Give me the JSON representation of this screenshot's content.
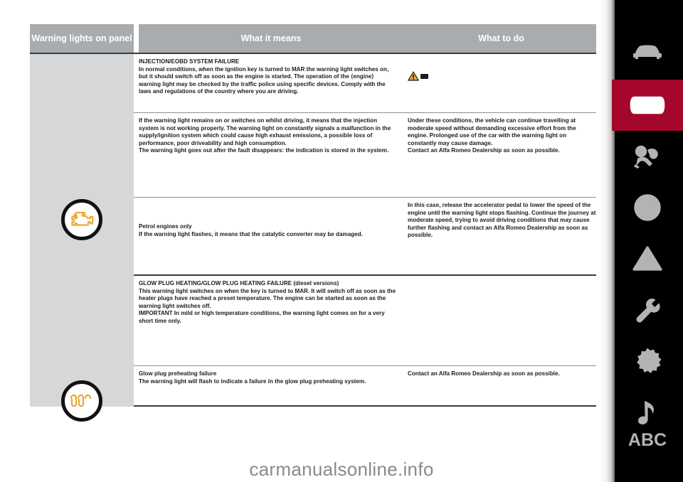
{
  "table": {
    "headers": {
      "col1": "Warning lights on panel",
      "col2": "What it means",
      "col3": "What to do"
    },
    "rows": [
      {
        "icon_name": "engine-check-warning-light",
        "icon_color": "#E8A830",
        "blocks": [
          {
            "means_title": "INJECTION/EOBD SYSTEM FAILURE",
            "means_body": "In normal conditions, when the ignition key is turned to MAR the warning light switches on, but it should switch off as soon as the engine is started. The operation of the ⟨engine⟩ warning light may be checked by the traffic police using specific devices. Comply with the laws and regulations of the country where you are driving.",
            "todo": ""
          },
          {
            "means_title": "",
            "means_body": "If the warning light remains on or switches on whilst driving, it means that the injection system is not working properly. The warning light on constantly signals a malfunction in the supply/ignition system which could cause high exhaust emissions, a possible loss of performance, poor driveability and high consumption.\nThe warning light goes out after the fault disappears: the indication is stored in the system.",
            "todo": "Under these conditions, the vehicle can continue travelling at moderate speed without demanding excessive effort from the engine. Prolonged use of the car with the warning light on constantly may cause damage.\nContact an Alfa Romeo Dealership as soon as possible."
          },
          {
            "means_title": "Petrol engines only",
            "means_body": "If the warning light flashes, it means that the catalytic converter may be damaged.",
            "todo": "In this case, release the accelerator pedal to lower the speed of the engine until the warning light stops flashing. Continue the journey at moderate speed, trying to avoid driving conditions that may cause further flashing and contact an Alfa Romeo Dealership as soon as possible."
          }
        ]
      },
      {
        "icon_name": "glow-plug-preheating-warning-light",
        "icon_color": "#E8A830",
        "blocks": [
          {
            "means_title": "GLOW PLUG HEATING/GLOW PLUG HEATING FAILURE (diesel versions)",
            "means_body": "This warning light switches on when the key is turned to MAR. It will switch off as soon as the heater plugs have reached a preset temperature. The engine can be started as soon as the warning light switches off.\nIMPORTANT In mild or high temperature conditions, the warning light comes on for a very short time only.",
            "todo": ""
          },
          {
            "means_title": "Glow plug preheating failure",
            "means_body": "The warning light will flash to indicate a failure in the glow plug preheating system.",
            "todo": "Contact an Alfa Romeo Dealership as soon as possible."
          }
        ]
      }
    ]
  },
  "sidebar": {
    "active_index": 1,
    "active_color": "#A4062C",
    "items": [
      {
        "icon": "car-front-icon",
        "label": ""
      },
      {
        "icon": "instrument-panel-icon",
        "label": ""
      },
      {
        "icon": "airbag-icon",
        "label": ""
      },
      {
        "icon": "steering-wheel-icon",
        "label": ""
      },
      {
        "icon": "warning-triangle-icon",
        "label": ""
      },
      {
        "icon": "wrench-icon",
        "label": ""
      },
      {
        "icon": "gear-info-icon",
        "label": ""
      },
      {
        "icon": "music-note-icon",
        "label": ""
      },
      {
        "icon": "abc-text-icon",
        "label": "ABC"
      }
    ]
  },
  "watermark": {
    "text": "carmanualsonline.info"
  }
}
